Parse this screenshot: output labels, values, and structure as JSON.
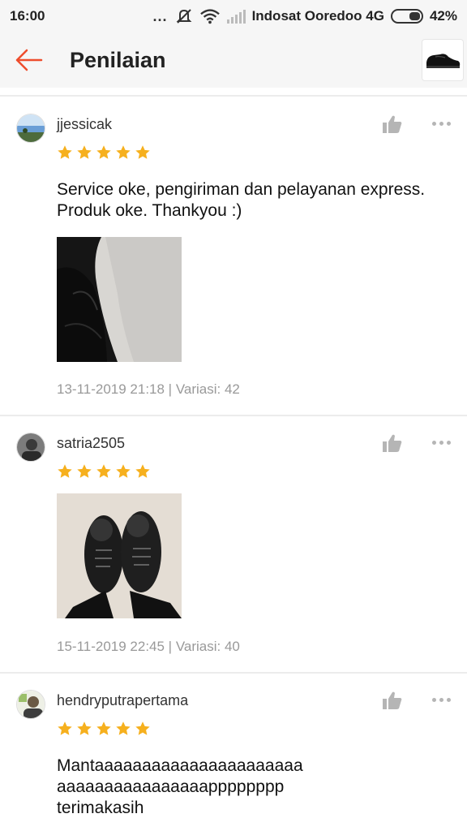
{
  "status_bar": {
    "time": "16:00",
    "dots": "...",
    "carrier": "Indosat Ooredoo 4G",
    "battery_percent": "42%",
    "battery_level": 0.42,
    "icons": [
      "mute-icon",
      "wifi-icon",
      "signal-icon",
      "battery-icon"
    ]
  },
  "header": {
    "title": "Penilaian",
    "back_icon": "arrow-left-icon",
    "accent_color": "#ee4d2d"
  },
  "colors": {
    "star": "#f6b01e",
    "meta_text": "#999999",
    "icon_gray": "#b5b5b5"
  },
  "reviews": [
    {
      "username": "jjessicak",
      "rating": 5,
      "text_lines": [
        "Service oke, pengiriman dan pelayanan express.",
        "Produk oke. Thankyou :)"
      ],
      "has_photo": true,
      "meta": "13-11-2019 21:18 | Variasi: 42"
    },
    {
      "username": "satria2505",
      "rating": 5,
      "text_lines": [],
      "has_photo": true,
      "meta": "15-11-2019 22:45 | Variasi: 40"
    },
    {
      "username": "hendryputrapertama",
      "rating": 5,
      "text_lines": [
        "Mantaaaaaaaaaaaaaaaaaaaaaa",
        "aaaaaaaaaaaaaaaapppppppp",
        "terimakasih"
      ],
      "has_photo": false,
      "meta": ""
    }
  ]
}
